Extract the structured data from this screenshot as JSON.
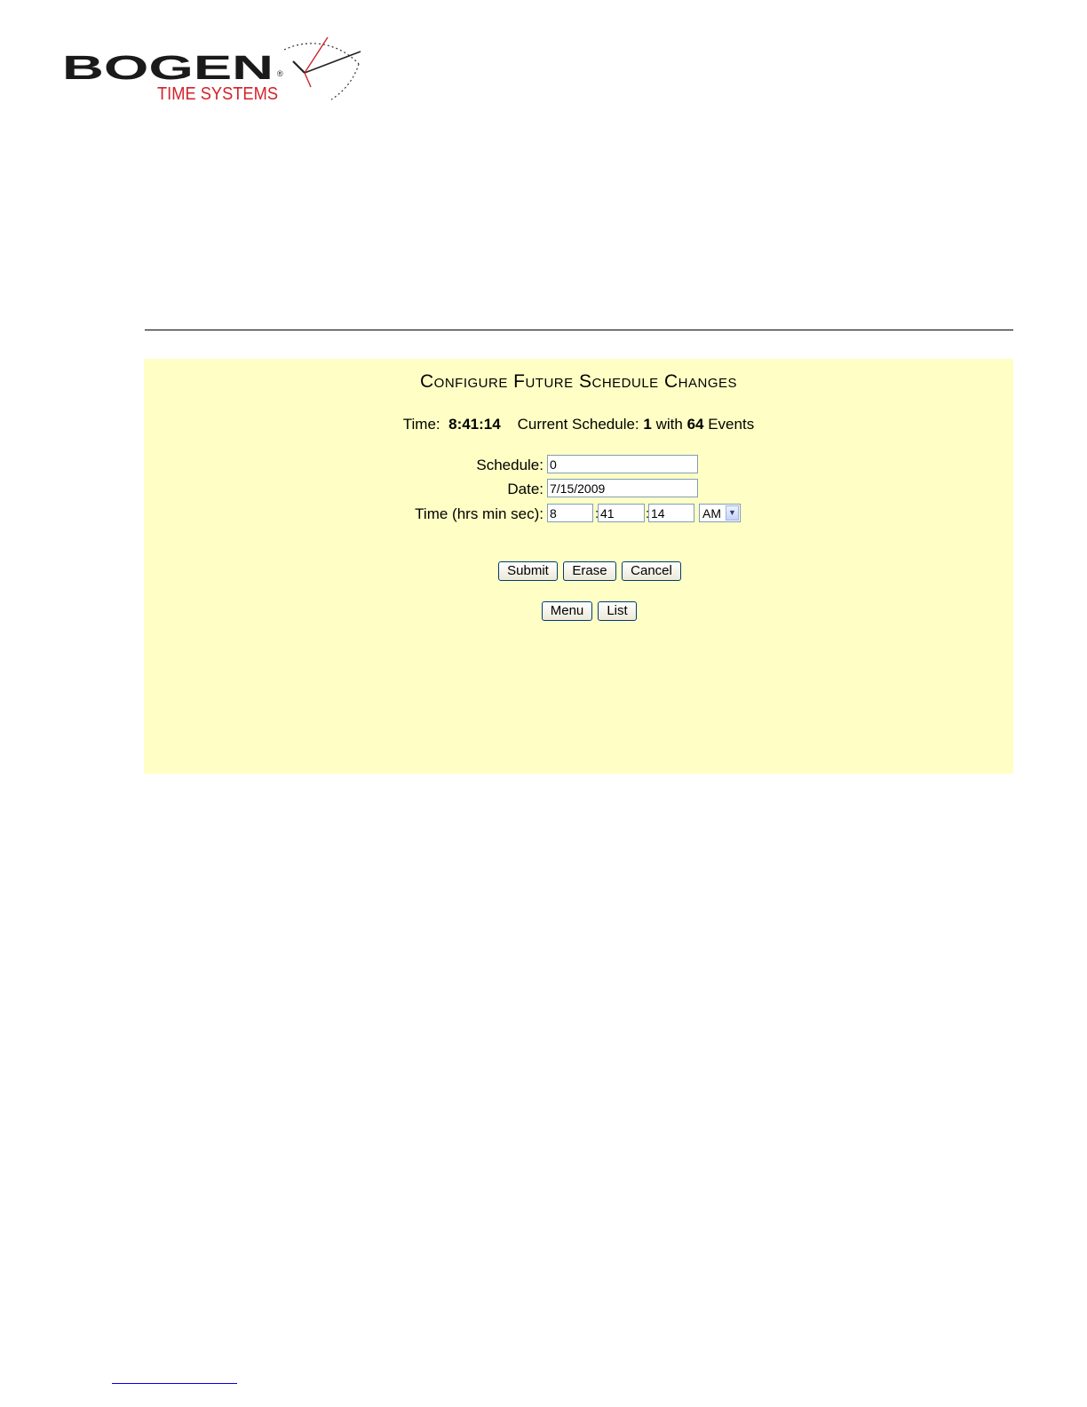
{
  "logo": {
    "brand": "BOGEN",
    "tagline": "TIME SYSTEMS",
    "registered_mark": "®",
    "brand_color": "#1a1a1a",
    "accent_color": "#d2232a"
  },
  "panel": {
    "background": "#ffffc5",
    "title": "Configure Future Schedule Changes",
    "status": {
      "time_label": "Time:",
      "time_value": "8:41:14",
      "schedule_label": "Current Schedule:",
      "schedule_value": "1",
      "with_text": "with",
      "events_count": "64",
      "events_label": "Events"
    },
    "form": {
      "schedule_label": "Schedule:",
      "schedule_value": "0",
      "date_label": "Date:",
      "date_value": "7/15/2009",
      "time_label": "Time (hrs min sec):",
      "hours_value": "8",
      "minutes_value": "41",
      "seconds_value": "14",
      "separator": ":",
      "ampm_value": "AM"
    },
    "buttons": {
      "submit": "Submit",
      "erase": "Erase",
      "cancel": "Cancel",
      "menu": "Menu",
      "list": "List"
    }
  }
}
